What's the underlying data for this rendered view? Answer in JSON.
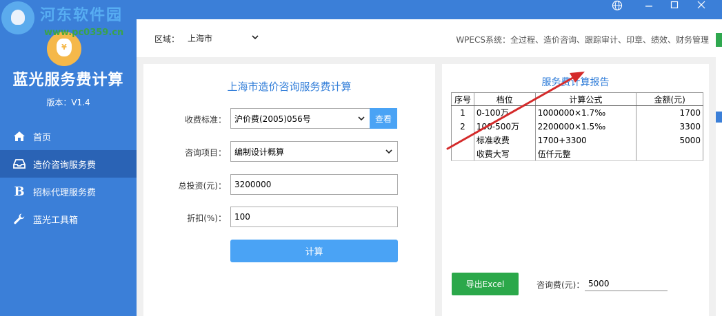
{
  "watermark": {
    "line1": "河东软件园",
    "line2": "www.pc0359.cn"
  },
  "window": {
    "icons": [
      "globe-icon",
      "minimize-icon",
      "maximize-icon",
      "close-icon"
    ]
  },
  "sidebar": {
    "app_title": "蓝光服务费计算",
    "version": "版本：V1.4",
    "items": [
      {
        "label": "首页",
        "icon": "home-icon"
      },
      {
        "label": "造价咨询服务费",
        "icon": "inbox-icon",
        "active": true
      },
      {
        "label": "招标代理服务费",
        "icon": "bold-b-icon"
      },
      {
        "label": "蓝光工具箱",
        "icon": "wrench-icon"
      }
    ]
  },
  "topbar": {
    "region_label": "区域：",
    "region_value": "上海市",
    "slogan": "WPECS系统：全过程、造价咨询、跟踪审计、印章、绩效、财务管理"
  },
  "form": {
    "title": "上海市造价咨询服务费计算",
    "standard_label": "收费标准：",
    "standard_value": "沪价费(2005)056号",
    "view_button": "查看",
    "item_label": "咨询项目：",
    "item_value": "编制设计概算",
    "investment_label": "总投资(元)：",
    "investment_value": "3200000",
    "discount_label": "折扣(%)：",
    "discount_value": "100",
    "calc_button": "计算"
  },
  "report": {
    "title": "服务费计算报告",
    "headers": [
      "序号",
      "档位",
      "计算公式",
      "金额(元)"
    ],
    "rows": [
      [
        "1",
        "0-100万",
        "1000000×1.7‰",
        "1700"
      ],
      [
        "2",
        "100-500万",
        "2200000×1.5‰",
        "3300"
      ],
      [
        "",
        "标准收费",
        "1700+3300",
        "5000"
      ],
      [
        "",
        "收费大写",
        "伍仟元整",
        ""
      ]
    ],
    "export_button": "导出Excel",
    "fee_label": "咨询费(元)：",
    "fee_value": "5000"
  },
  "colors": {
    "sidebar": "#3b7fd8",
    "active_nav": "#2a63b5",
    "button_blue": "#4aa3f5",
    "export_green": "#2ba84a",
    "title_blue": "#2f7cd8",
    "arrow_red": "#d42a2a"
  }
}
